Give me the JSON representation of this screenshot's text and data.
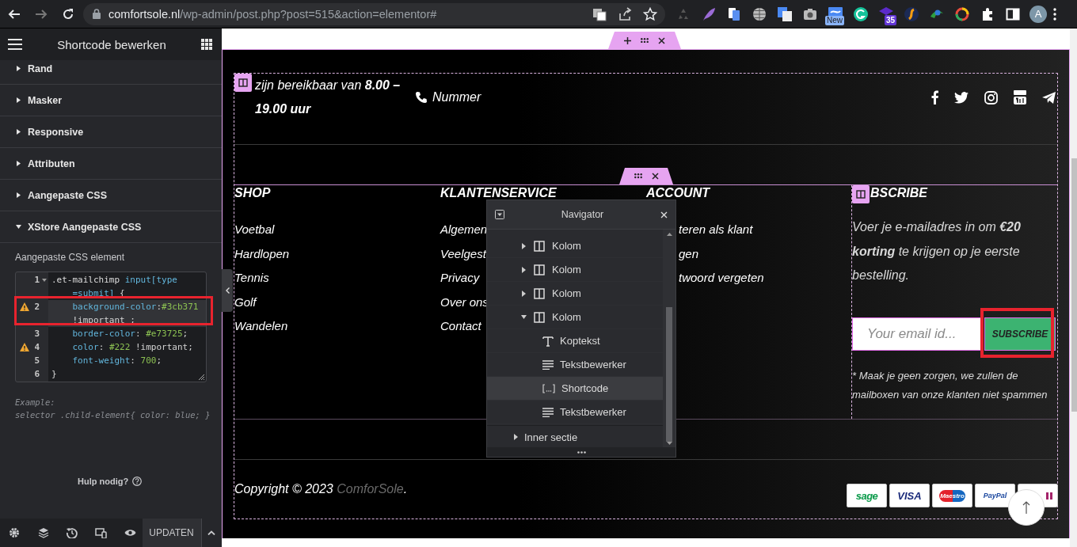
{
  "browser": {
    "url_host": "comfortsole.nl",
    "url_path": "/wp-admin/post.php?post=515&action=elementor#",
    "new_badge": "New",
    "count_badge": "35",
    "avatar": "A"
  },
  "panel": {
    "title": "Shortcode bewerken",
    "sections": [
      {
        "label": "Rand",
        "expanded": false
      },
      {
        "label": "Masker",
        "expanded": false
      },
      {
        "label": "Responsive",
        "expanded": false
      },
      {
        "label": "Attributen",
        "expanded": false
      },
      {
        "label": "Aangepaste CSS",
        "expanded": false
      },
      {
        "label": "XStore Aangepaste CSS",
        "expanded": true
      }
    ],
    "css_label": "Aangepaste CSS element",
    "code_lines": [
      {
        "number": "1",
        "warning": false,
        "foldable": true,
        "active": false,
        "tokens": [
          {
            "text": ".et-mailchimp ",
            "kind": "selector"
          },
          {
            "text": "input[type",
            "kind": "keyword"
          },
          {
            "text": "=submit]",
            "kind": "keyword"
          },
          {
            "text": " {",
            "kind": "plain"
          }
        ]
      },
      {
        "number": "2",
        "warning": true,
        "foldable": false,
        "active": true,
        "tokens": [
          {
            "text": "    background-color",
            "kind": "property"
          },
          {
            "text": ":",
            "kind": "plain"
          },
          {
            "text": "#3cb371",
            "kind": "value"
          },
          {
            "text": " !important",
            "kind": "plain"
          },
          {
            "text": " ;",
            "kind": "plain"
          }
        ]
      },
      {
        "number": "3",
        "warning": false,
        "foldable": false,
        "active": false,
        "tokens": [
          {
            "text": "    border-color",
            "kind": "property"
          },
          {
            "text": ": ",
            "kind": "plain"
          },
          {
            "text": "#e73725",
            "kind": "value"
          },
          {
            "text": ";",
            "kind": "plain"
          }
        ]
      },
      {
        "number": "4",
        "warning": true,
        "foldable": false,
        "active": false,
        "tokens": [
          {
            "text": "    color",
            "kind": "property"
          },
          {
            "text": ": ",
            "kind": "plain"
          },
          {
            "text": "#222",
            "kind": "value"
          },
          {
            "text": " !important;",
            "kind": "plain"
          }
        ]
      },
      {
        "number": "5",
        "warning": false,
        "foldable": false,
        "active": false,
        "tokens": [
          {
            "text": "    font-weight",
            "kind": "property"
          },
          {
            "text": ": ",
            "kind": "plain"
          },
          {
            "text": "700",
            "kind": "value"
          },
          {
            "text": ";",
            "kind": "plain"
          }
        ]
      },
      {
        "number": "6",
        "warning": false,
        "foldable": false,
        "active": false,
        "tokens": [
          {
            "text": "}",
            "kind": "plain"
          }
        ]
      }
    ],
    "example_lines": [
      "Example:",
      "selector .child-element{ color: blue; }"
    ],
    "help": "Hulp nodig?",
    "update_button": "UPDATEN"
  },
  "page": {
    "hours": "zijn bereikbaar van **8.00 – 19.00 uur**",
    "phone": "Nummer",
    "columns": [
      {
        "heading": "SHOP",
        "links": [
          "Voetbal",
          "Hardlopen",
          "Tennis",
          "Golf",
          "Wandelen"
        ]
      },
      {
        "heading": "KLANTENSERVICE",
        "links": [
          "Algemen",
          "Veelgest",
          "Privacy",
          "Over ons",
          "Contact"
        ]
      },
      {
        "heading": "ACCOUNT",
        "links": [
          "teren als klant",
          "gen",
          "twoord vergeten"
        ]
      }
    ],
    "subscribe": {
      "heading": "BSCRIBE",
      "text": "Voer je e-mailadres in om **€20 korting** te krijgen op je eerste bestelling.",
      "placeholder": "Your email id...",
      "button": "SUBSCRIBE",
      "note": "* Maak je geen zorgen, we zullen de mailboxen van onze klanten niet spammen"
    },
    "copyright": {
      "text": "Copyright © 2023",
      "link": "ComforSole",
      "suffix": "."
    },
    "payments": [
      "sage",
      "VISA",
      "Maestro",
      "PayPal"
    ]
  },
  "navigator": {
    "title": "Navigator",
    "items": [
      {
        "label": "Kolom",
        "kind": "column",
        "expanded": false,
        "selected": false
      },
      {
        "label": "Kolom",
        "kind": "column",
        "expanded": false,
        "selected": false
      },
      {
        "label": "Kolom",
        "kind": "column",
        "expanded": false,
        "selected": false
      },
      {
        "label": "Kolom",
        "kind": "column",
        "expanded": true,
        "selected": false,
        "children": [
          {
            "label": "Koptekst",
            "kind": "heading",
            "selected": false
          },
          {
            "label": "Tekstbewerker",
            "kind": "text-editor",
            "selected": false
          },
          {
            "label": "Shortcode",
            "kind": "shortcode",
            "selected": true
          },
          {
            "label": "Tekstbewerker",
            "kind": "text-editor",
            "selected": false
          }
        ]
      },
      {
        "label": "Inner sectie",
        "kind": "inner-section",
        "expanded": false,
        "selected": false
      }
    ]
  }
}
